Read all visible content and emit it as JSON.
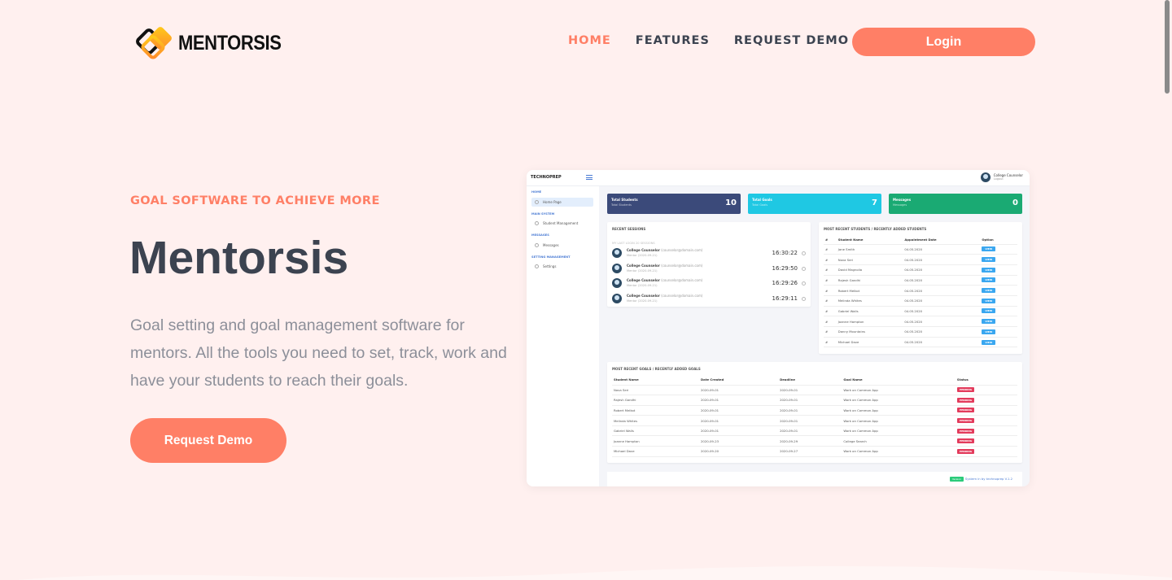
{
  "brand": {
    "name": "MENTORSIS"
  },
  "nav": {
    "items": [
      "HOME",
      "FEATURES",
      "REQUEST DEMO"
    ],
    "login": "Login"
  },
  "hero": {
    "eyebrow": "GOAL SOFTWARE TO ACHIEVE MORE",
    "title": "Mentorsis",
    "description": "Goal setting and goal management software for mentors. All the tools you need to set, track, work and have your students to reach their goals.",
    "cta": "Request Demo"
  },
  "colors": {
    "accent": "#ff7f66",
    "background": "#fff0ef",
    "heading": "#3c4350"
  },
  "dashboard": {
    "brand": "TECHNOPREP",
    "user": {
      "name": "College Counselor",
      "sub": "Logout"
    },
    "sidebar": {
      "home_section": "HOME",
      "home_item": "Home Page",
      "main_section": "MAIN SYSTEM",
      "main_item": "Student Management",
      "messages_section": "MESSAGES",
      "messages_item": "Messages",
      "settings_section": "SETTING MANAGEMENT",
      "settings_item": "Settings"
    },
    "stats": [
      {
        "label": "Total Students",
        "sub": "Total Students",
        "value": "10",
        "color": "#3b4a7a"
      },
      {
        "label": "Total Goals",
        "sub": "Total Goals",
        "value": "7",
        "color": "#1fc8e3"
      },
      {
        "label": "Messages",
        "sub": "Messages",
        "value": "0",
        "color": "#1aaa73"
      }
    ],
    "sessions": {
      "title": "RECENT SESSIONS",
      "subtitle": "MY LAST LOGIN 20 SESSIONS",
      "items": [
        {
          "name": "College Counselor",
          "email": "(counselor@domain.com)",
          "meta": "Mentor (2020-09-21)",
          "time": "16:30:22"
        },
        {
          "name": "College Counselor",
          "email": "(counselor@domain.com)",
          "meta": "Mentor (2020-09-21)",
          "time": "16:29:50"
        },
        {
          "name": "College Counselor",
          "email": "(counselor@domain.com)",
          "meta": "Mentor (2020-09-21)",
          "time": "16:29:26"
        },
        {
          "name": "College Counselor",
          "email": "(counselor@domain.com)",
          "meta": "Mentor (2020-09-21)",
          "time": "16:29:11"
        }
      ]
    },
    "students": {
      "title": "MOST RECENT STUDENTS / RECENTLY ADDED STUDENTS",
      "headers": [
        "#",
        "Student Name",
        "Appointment Date",
        "Option"
      ],
      "action": "VIEW",
      "rows": [
        {
          "n": "#",
          "name": "Jane Smith",
          "date": "04.05.2020"
        },
        {
          "n": "#",
          "name": "Nova Seri",
          "date": "04.05.2020"
        },
        {
          "n": "#",
          "name": "David Magnolia",
          "date": "04.05.2020"
        },
        {
          "n": "#",
          "name": "Rajesh Gandhi",
          "date": "04.05.2020"
        },
        {
          "n": "#",
          "name": "Robert Melkot",
          "date": "04.05.2020"
        },
        {
          "n": "#",
          "name": "Melinda Whites",
          "date": "04.05.2020"
        },
        {
          "n": "#",
          "name": "Gabriel Walls",
          "date": "04.05.2020"
        },
        {
          "n": "#",
          "name": "Joanne Hampton",
          "date": "04.05.2020"
        },
        {
          "n": "#",
          "name": "Danny Mountains",
          "date": "04.05.2020"
        },
        {
          "n": "#",
          "name": "Michael Dave",
          "date": "04.05.2020"
        }
      ]
    },
    "goals": {
      "title": "MOST RECENT GOALS / RECENTLY ADDED GOALS",
      "headers": [
        "Student Name",
        "Date Created",
        "Deadline",
        "Goal Name",
        "Status"
      ],
      "status": "PENDING",
      "rows": [
        {
          "name": "Nova Seri",
          "created": "2020-09-01",
          "deadline": "2020-09-01",
          "goal": "Work on Common App"
        },
        {
          "name": "Rajesh Gandhi",
          "created": "2020-09-01",
          "deadline": "2020-09-01",
          "goal": "Work on Common App"
        },
        {
          "name": "Robert Melkot",
          "created": "2020-09-01",
          "deadline": "2020-09-01",
          "goal": "Work on Common App"
        },
        {
          "name": "Melinda Whites",
          "created": "2020-09-01",
          "deadline": "2020-09-01",
          "goal": "Work on Common App"
        },
        {
          "name": "Gabriel Walls",
          "created": "2020-09-01",
          "deadline": "2020-09-01",
          "goal": "Work on Common App"
        },
        {
          "name": "Joanne Hampton",
          "created": "2020-09-23",
          "deadline": "2020-09-29",
          "goal": "College Search"
        },
        {
          "name": "Michael Dave",
          "created": "2020-09-20",
          "deadline": "2020-09-27",
          "goal": "Work on Common App"
        }
      ]
    },
    "footer": {
      "badge": "Version",
      "text": "System in by technoprep V.1.2"
    }
  }
}
